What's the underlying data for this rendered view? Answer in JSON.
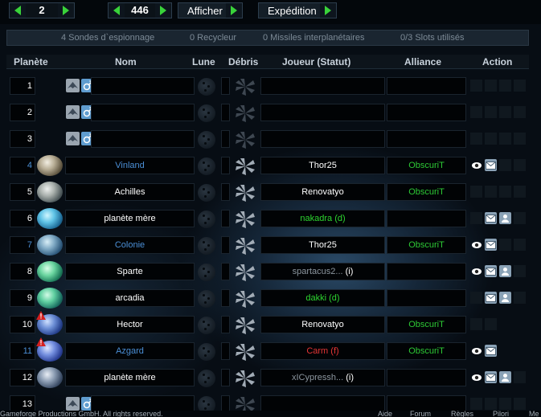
{
  "navigation": {
    "galaxy": "2",
    "system": "446",
    "show_label": "Afficher",
    "expedition_label": "Expédition"
  },
  "info": {
    "probes": "4 Sondes d`espionnage",
    "recyclers": "0 Recycleur",
    "missiles": "0 Missiles interplanétaires",
    "slots": "0/3 Slots utilisés"
  },
  "headers": {
    "planet": "Planète",
    "name": "Nom",
    "moon": "Lune",
    "debris": "Débris",
    "player": "Joueur (Statut)",
    "alliance": "Alliance",
    "action": "Action"
  },
  "colors": {
    "link_blue": "#4b8fd6",
    "alliance_green": "#2dc935",
    "status_red": "#e63535"
  },
  "rows": [
    {
      "pos": "1",
      "name": "",
      "player": "",
      "status": "",
      "alliance": "",
      "empty": true
    },
    {
      "pos": "2",
      "name": "",
      "player": "",
      "status": "",
      "alliance": "",
      "empty": true
    },
    {
      "pos": "3",
      "name": "",
      "player": "",
      "status": "",
      "alliance": "",
      "empty": true
    },
    {
      "pos": "4",
      "name": "Vinland",
      "player": "Thor25",
      "status": "",
      "alliance": "ObscuriT"
    },
    {
      "pos": "5",
      "name": "Achilles",
      "player": "Renovatyo",
      "status": "",
      "alliance": "ObscuriT"
    },
    {
      "pos": "6",
      "name": "planète mère",
      "player": "nakadra",
      "status": "(d)",
      "alliance": ""
    },
    {
      "pos": "7",
      "name": "Colonie",
      "player": "Thor25",
      "status": "",
      "alliance": "ObscuriT"
    },
    {
      "pos": "8",
      "name": "Sparte",
      "player": "spartacus2...",
      "status": "(i)",
      "alliance": ""
    },
    {
      "pos": "9",
      "name": "arcadia",
      "player": "dakki",
      "status": "(d)",
      "alliance": ""
    },
    {
      "pos": "10",
      "name": "Hector",
      "player": "Renovatyo",
      "status": "",
      "alliance": "ObscuriT"
    },
    {
      "pos": "11",
      "name": "Azgard",
      "player": "Carm",
      "status": "(f)",
      "alliance": "ObscuriT"
    },
    {
      "pos": "12",
      "name": "planète mère",
      "player": "xICypressh...",
      "status": "(i)",
      "alliance": ""
    },
    {
      "pos": "13",
      "name": "",
      "player": "",
      "status": "",
      "alliance": "",
      "empty": true
    }
  ],
  "footer": {
    "copyright": "Gameforge Productions GmbH. All rights reserved.",
    "help": "Aide",
    "forum": "Forum",
    "rules": "Règles",
    "pillory": "Pilori",
    "more": "Me"
  }
}
